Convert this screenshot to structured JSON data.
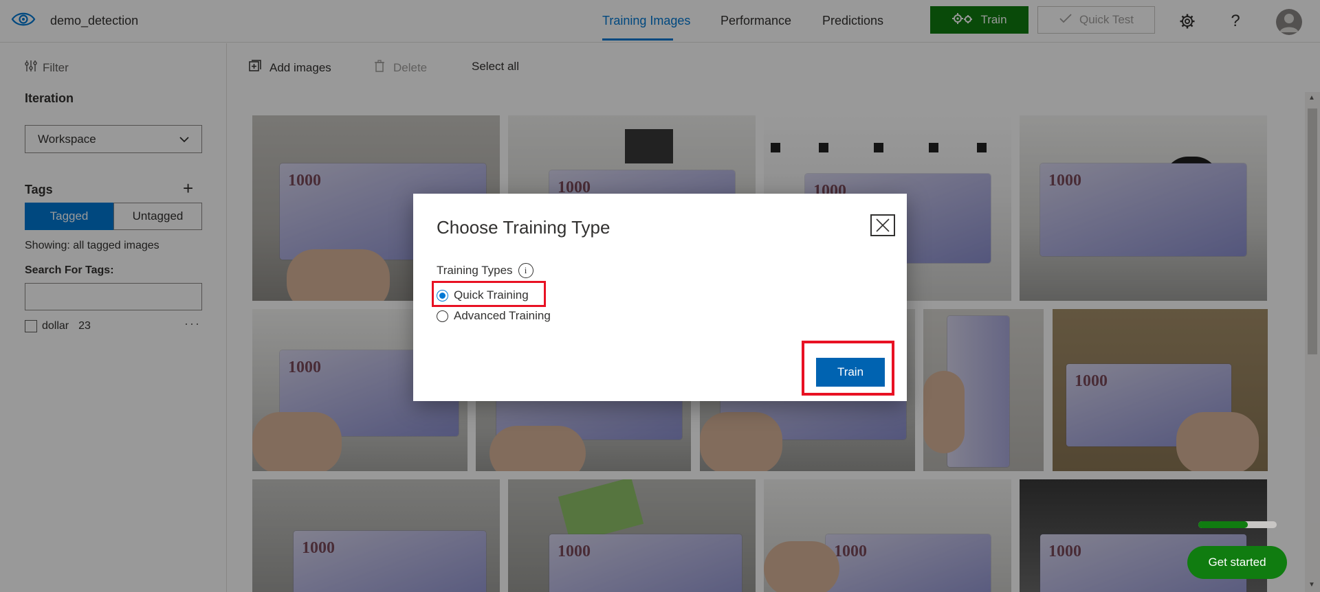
{
  "app": {
    "project_name": "demo_detection"
  },
  "nav": {
    "tabs": [
      {
        "label": "Training Images",
        "active": true
      },
      {
        "label": "Performance",
        "active": false
      },
      {
        "label": "Predictions",
        "active": false
      }
    ],
    "train_label": "Train",
    "quick_test_label": "Quick Test",
    "help_label": "?"
  },
  "sidebar": {
    "filter_label": "Filter",
    "iteration_label": "Iteration",
    "iteration_value": "Workspace",
    "tags_label": "Tags",
    "segment": {
      "tagged": "Tagged",
      "untagged": "Untagged"
    },
    "showing_text": "Showing: all tagged images",
    "search_label": "Search For Tags:",
    "search_value": "",
    "tags": [
      {
        "name": "dollar",
        "count": "23"
      }
    ],
    "more_label": "···"
  },
  "toolbar": {
    "add_images": "Add images",
    "delete": "Delete",
    "select_all": "Select all"
  },
  "images": {
    "banknote_label": "1000",
    "count_visible": 13
  },
  "modal": {
    "title": "Choose Training Type",
    "types_label": "Training Types",
    "info_symbol": "i",
    "options": [
      {
        "label": "Quick Training",
        "selected": true
      },
      {
        "label": "Advanced Training",
        "selected": false
      }
    ],
    "train_label": "Train"
  },
  "get_started": {
    "label": "Get started",
    "progress": 0.63
  },
  "colors": {
    "accent": "#0078d4",
    "train_green": "#107c10",
    "highlight_red": "#e81123"
  }
}
